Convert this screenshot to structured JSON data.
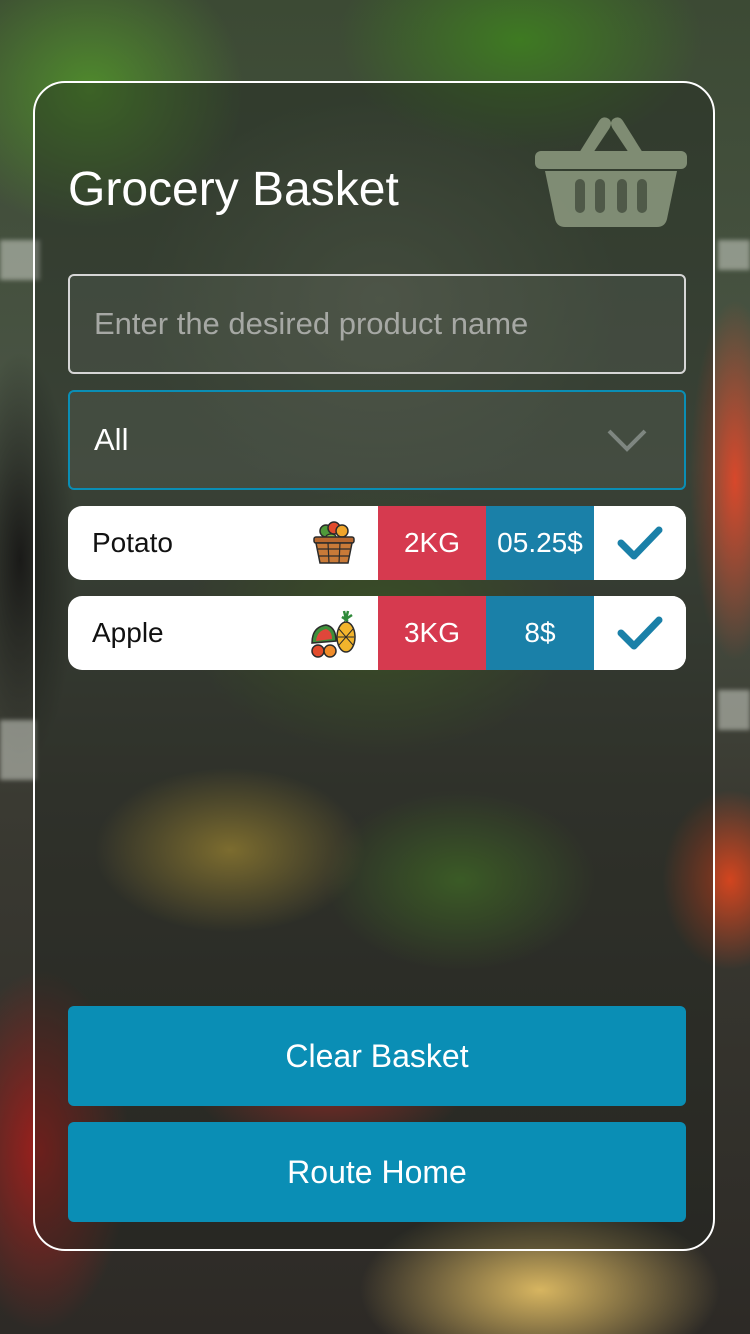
{
  "page": {
    "title": "Grocery Basket"
  },
  "search": {
    "value": "",
    "placeholder": "Enter the desired product name"
  },
  "filter": {
    "selected": "All"
  },
  "items": [
    {
      "name": "Potato",
      "icon": "vegetable-basket-icon",
      "quantity": "2KG",
      "price": "05.25$",
      "checked": true
    },
    {
      "name": "Apple",
      "icon": "fruits-icon",
      "quantity": "3KG",
      "price": "8$",
      "checked": true
    }
  ],
  "actions": {
    "clear_label": "Clear Basket",
    "home_label": "Route Home"
  },
  "colors": {
    "accent": "#0a8eb5",
    "quantity_bg": "#d63a4f",
    "price_bg": "#1a80a8",
    "check": "#1a80a8",
    "border": "#ffffff"
  }
}
